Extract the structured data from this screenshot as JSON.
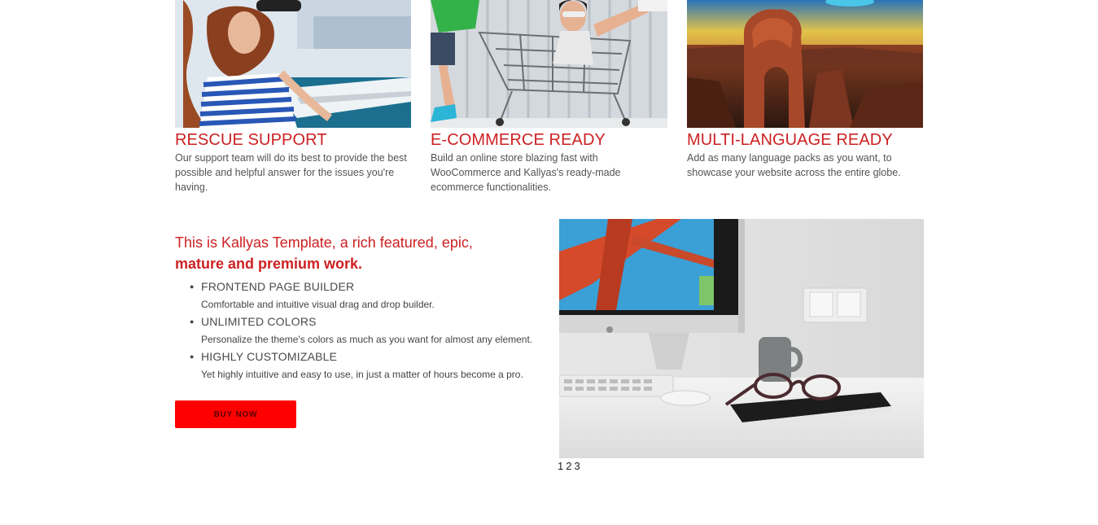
{
  "features": [
    {
      "title": "RESCUE SUPPORT",
      "text": "Our support team will do its best to provide the best possible and helpful answer for the issues you're having."
    },
    {
      "title": "E-COMMERCE READY",
      "text": "Build an online store blazing fast with WooCommerce and Kallyas's ready-made ecommerce functionalities."
    },
    {
      "title": "MULTI-LANGUAGE READY",
      "text": "Add as many language packs as you want, to showcase your website across the entire globe."
    }
  ],
  "promo": {
    "heading_line1": "This is Kallyas Template, a rich featured, epic,",
    "heading_line2": "mature and premium work.",
    "items": [
      {
        "title": "FRONTEND PAGE BUILDER",
        "desc": "Comfortable and intuitive visual drag and drop builder."
      },
      {
        "title": "UNLIMITED COLORS",
        "desc": "Personalize the theme's colors as much as you want for almost any element."
      },
      {
        "title": "HIGHLY CUSTOMIZABLE",
        "desc": "Yet highly intuitive and easy to use, in just a matter of hours become a pro."
      }
    ],
    "button_label": "BUY NOW"
  },
  "slider": {
    "pages": [
      "1",
      "2",
      "3"
    ]
  },
  "colors": {
    "accent": "#cd2122",
    "button": "#ff0000"
  }
}
